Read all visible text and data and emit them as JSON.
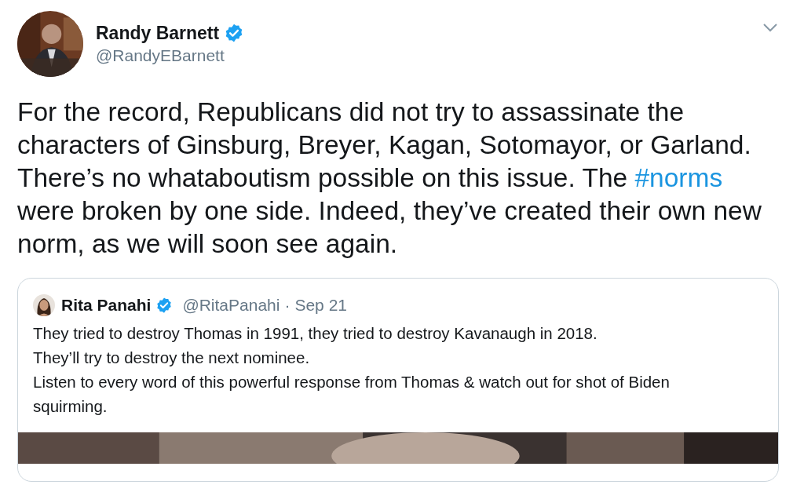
{
  "author": {
    "name": "Randy Barnett",
    "verified": true,
    "handle": "@RandyEBarnett"
  },
  "tweet": {
    "text_before": "For the record, Republicans did not try to assassinate the characters of Ginsburg, Breyer, Kagan, Sotomayor, or Garland. There’s no whataboutism possible on this issue. The ",
    "hashtag": "#norms",
    "text_after": " were broken by one side. Indeed, they’ve created their own new norm, as we will soon see again."
  },
  "quoted_tweet": {
    "name": "Rita Panahi",
    "verified": true,
    "handle": "@RitaPanahi",
    "separator": "·",
    "date": "Sep 21",
    "lines": [
      "They tried to destroy Thomas in 1991, they tried to destroy Kavanaugh in 2018.",
      "They’ll try to destroy the next nominee.",
      "Listen to every word of this powerful response from Thomas & watch out for shot of Biden squirming."
    ]
  }
}
